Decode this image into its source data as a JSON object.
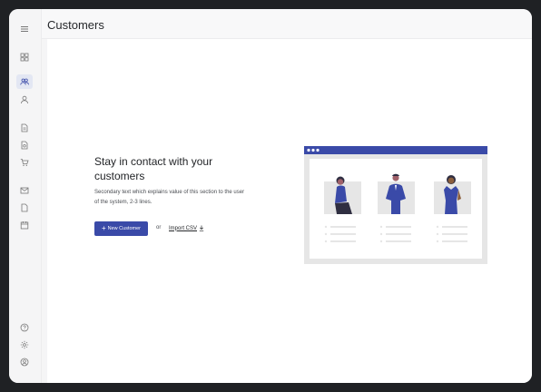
{
  "header": {
    "title": "Customers"
  },
  "sidebar": {
    "items": [
      {
        "name": "menu-icon"
      },
      {
        "name": "dashboard-icon"
      },
      {
        "name": "customers-icon",
        "active": true
      },
      {
        "name": "user-icon"
      },
      {
        "name": "document-icon"
      },
      {
        "name": "invoice-icon"
      },
      {
        "name": "cart-icon"
      },
      {
        "name": "mail-icon"
      },
      {
        "name": "file-icon"
      },
      {
        "name": "calendar-icon"
      },
      {
        "name": "help-icon"
      },
      {
        "name": "settings-icon"
      },
      {
        "name": "account-icon"
      }
    ]
  },
  "empty_state": {
    "heading": "Stay in contact with your customers",
    "description": "Secondary text which explains value of this section to the user of the system, 2-3 lines.",
    "primary_button": "New Customer",
    "or_text": "or",
    "secondary_link": "Import CSV"
  },
  "colors": {
    "accent": "#3a4aa8",
    "sidebar_active_bg": "#e3e7f3",
    "app_bg": "#1f2124"
  }
}
